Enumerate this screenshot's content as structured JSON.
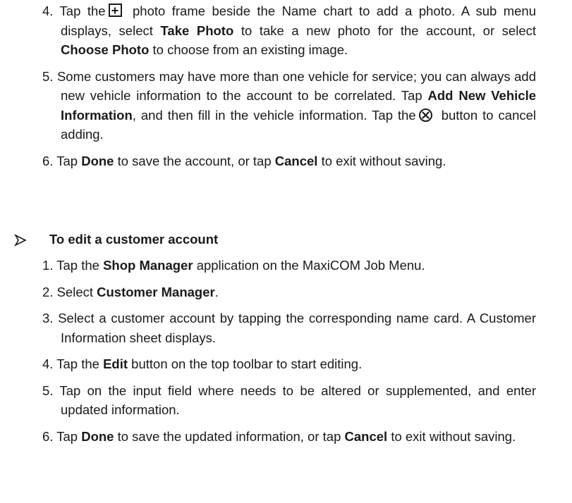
{
  "section1": {
    "steps": [
      {
        "num": "4.",
        "t1": "Tap the",
        "icon": "plus-box-icon",
        "t2": "photo frame beside the Name chart to add a photo. A sub menu displays, select",
        "b1": "Take Photo",
        "t3": "to take a new photo for the account, or select",
        "b2": "Choose Photo",
        "t4": "to choose from an existing image."
      },
      {
        "num": "5.",
        "t1": "Some customers may have more than one vehicle for service; you can always add new vehicle information to the account to be correlated. Tap",
        "b1": "Add New Vehicle Information",
        "t2": ", and then fill in the vehicle information. Tap the",
        "icon": "circle-x-icon",
        "t3": "button to cancel adding."
      },
      {
        "num": "6.",
        "t1": "Tap",
        "b1": "Done",
        "t2": "to save the account, or tap",
        "b2": "Cancel",
        "t3": "to exit without saving."
      }
    ]
  },
  "heading": {
    "icon": "arrowhead-bullet-icon",
    "text": "To edit a customer account"
  },
  "section2": {
    "steps": [
      {
        "num": "1.",
        "t1": "Tap the",
        "b1": "Shop Manager",
        "t2": "application on the MaxiCOM Job Menu."
      },
      {
        "num": "2.",
        "t1": "Select",
        "b1": "Customer Manager",
        "t2": "."
      },
      {
        "num": "3.",
        "t1": "Select a customer account by tapping the corresponding name card. A Customer Information sheet displays."
      },
      {
        "num": "4.",
        "t1": "Tap the",
        "b1": "Edit",
        "t2": "button on the top toolbar to start editing."
      },
      {
        "num": "5.",
        "t1": "Tap on the input field where needs to be altered or supplemented, and enter updated information."
      },
      {
        "num": "6.",
        "t1": "Tap",
        "b1": "Done",
        "t2": "to save the updated information, or tap",
        "b2": "Cancel",
        "t3": "to exit without saving."
      }
    ]
  }
}
